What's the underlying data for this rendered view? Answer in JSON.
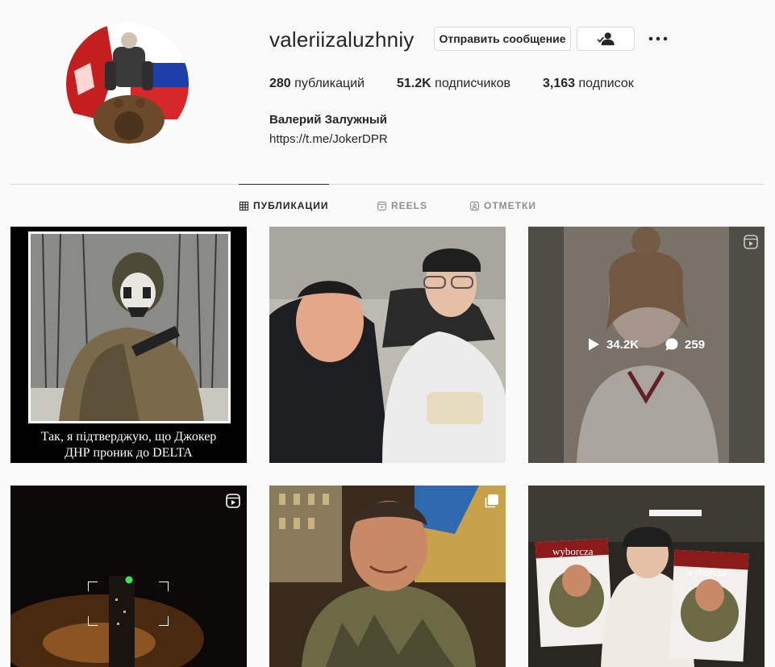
{
  "profile": {
    "username": "valeriizaluzhniy",
    "full_name": "Валерий Залужный",
    "bio_link": "https://t.me/JokerDPR"
  },
  "actions": {
    "message_label": "Отправить сообщение",
    "follow_icon": "person-check-icon",
    "more_icon": "more-options-icon"
  },
  "stats": {
    "posts_count": "280",
    "posts_label": "публикаций",
    "followers_count": "51.2K",
    "followers_label": "подписчиков",
    "following_count": "3,163",
    "following_label": "подписок"
  },
  "tabs": [
    {
      "label": "ПУБЛИКАЦИИ",
      "icon": "grid-icon",
      "active": true
    },
    {
      "label": "REELS",
      "icon": "reels-icon",
      "active": false
    },
    {
      "label": "ОТМЕТКИ",
      "icon": "tagged-icon",
      "active": false
    }
  ],
  "posts": [
    {
      "caption_line1": "Так, я підтверджую, що Джокер",
      "caption_line2": "ДНР проник до DELTA",
      "type": "image"
    },
    {
      "type": "image"
    },
    {
      "type": "reel",
      "plays": "34.2K",
      "comments": "259"
    },
    {
      "type": "reel"
    },
    {
      "type": "carousel"
    },
    {
      "type": "image",
      "newspaper": "wyborcza"
    }
  ],
  "colors": {
    "accent_text": "#262626",
    "muted_text": "#8e8e8e",
    "border": "#dbdbdb",
    "background": "#fafafa"
  }
}
